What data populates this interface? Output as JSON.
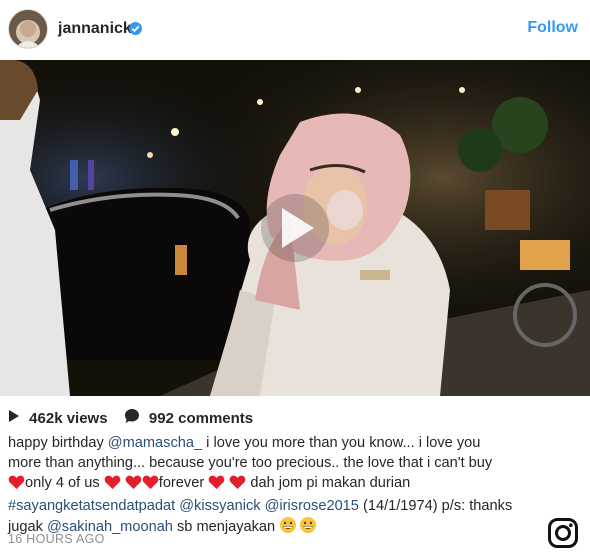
{
  "post": {
    "username": "jannanick",
    "follow_label": "Follow",
    "views": "462k views",
    "comments": "992 comments",
    "caption": {
      "l1_a": "happy birthday ",
      "l1_mention": "@mamascha_",
      "l1_b": " i love you more than you know... i love you",
      "l2": "more than anything... because you're too precious.. the love that i can't buy",
      "l3_a": "only 4 of us",
      "l3_b": "forever",
      "l3_c": "dah jom pi makan durian",
      "l4_hashtag": "#sayangketatsendatpadat",
      "l4_m1": "@kissyanick",
      "l4_m2": "@irisrose2015",
      "l4_rest": " (14/1/1974) p/s: thanks",
      "l5_a": "jugak ",
      "l5_mention": "@sakinah_moonah",
      "l5_b": " sb menjayakan "
    },
    "timestamp": "16 HOURS AGO"
  },
  "icons": {
    "avatar": "profile-avatar",
    "verified": "verified-badge-icon",
    "play": "play-icon",
    "views": "play-triangle-icon",
    "comments": "comment-bubble-icon",
    "heart": "red-heart-emoji",
    "emoji": "grinning-emoji",
    "logo": "instagram-logo-icon"
  },
  "colors": {
    "link": "#2b4f77",
    "accent": "#3897f0",
    "heart": "#e0202e",
    "muted": "#8e8e8e"
  }
}
